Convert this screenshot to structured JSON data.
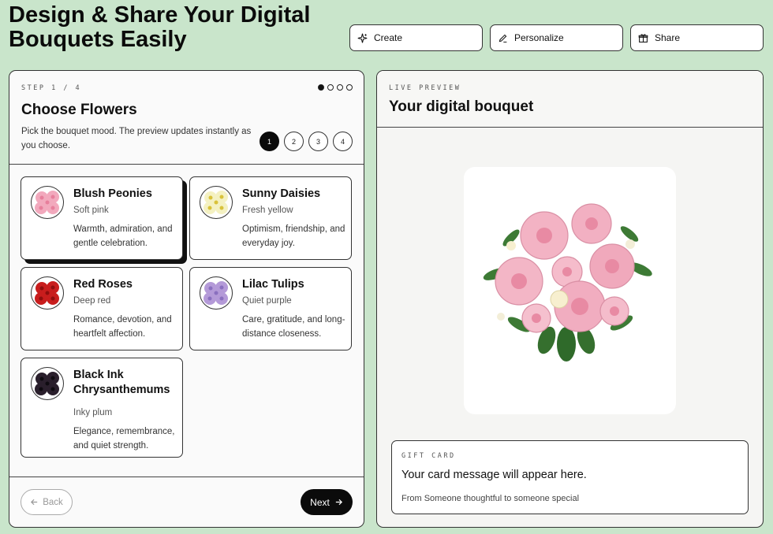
{
  "headline": "Design & Share Your Digital Bouquets Easily",
  "top_actions": [
    {
      "label": "Create",
      "icon": "sparkle-icon"
    },
    {
      "label": "Personalize",
      "icon": "pencil-icon"
    },
    {
      "label": "Share",
      "icon": "gift-icon"
    }
  ],
  "builder": {
    "eyebrow": "STEP 1 / 4",
    "progress_dots": 4,
    "progress_active": 1,
    "title": "Choose Flowers",
    "subtitle": "Pick the bouquet mood. The preview updates instantly as you choose.",
    "steps": [
      "1",
      "2",
      "3",
      "4"
    ],
    "active_step": "1",
    "flowers": [
      {
        "name": "Blush Peonies",
        "tone": "Soft pink",
        "desc": "Warmth, admiration, and gentle celebration.",
        "selected": true,
        "color": "#f2a9bd",
        "center": "#e77f9c"
      },
      {
        "name": "Sunny Daisies",
        "tone": "Fresh yellow",
        "desc": "Optimism, friendship, and everyday joy.",
        "selected": false,
        "color": "#f4f1c2",
        "center": "#d9c23a"
      },
      {
        "name": "Red Roses",
        "tone": "Deep red",
        "desc": "Romance, devotion, and heartfelt affection.",
        "selected": false,
        "color": "#c81d1d",
        "center": "#8e0d0d"
      },
      {
        "name": "Lilac Tulips",
        "tone": "Quiet purple",
        "desc": "Care, gratitude, and long-distance closeness.",
        "selected": false,
        "color": "#b49ad8",
        "center": "#8a6fbf"
      },
      {
        "name": "Black Ink Chrysanthemums",
        "tone": "Inky plum",
        "desc": "Elegance, remembrance, and quiet strength.",
        "selected": false,
        "color": "#2a1f2c",
        "center": "#0e0a10"
      }
    ],
    "back_label": "Back",
    "next_label": "Next"
  },
  "preview": {
    "eyebrow": "LIVE PREVIEW",
    "title": "Your digital bouquet",
    "gift_eyebrow": "GIFT CARD",
    "gift_message": "Your card message will appear here.",
    "gift_from": "From Someone thoughtful to someone special"
  }
}
